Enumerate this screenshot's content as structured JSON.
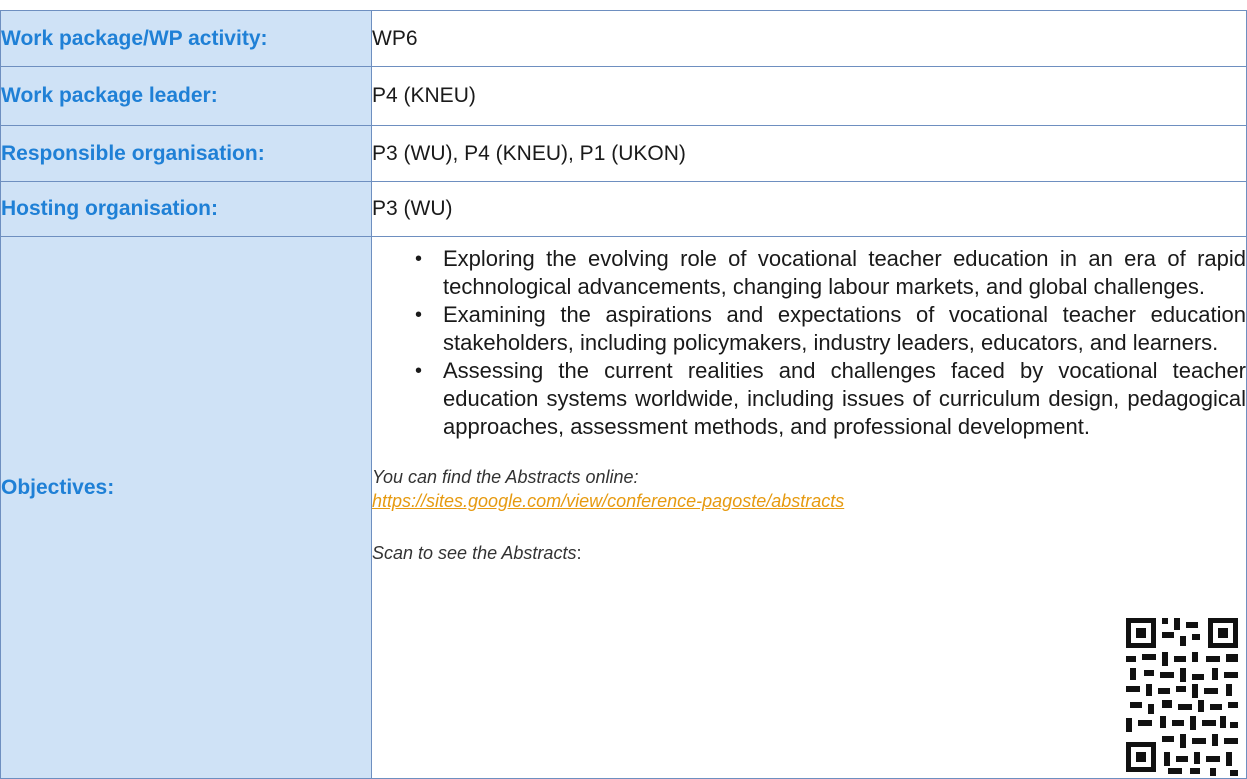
{
  "rows": [
    {
      "label": "Work package/WP activity:",
      "value": "WP6"
    },
    {
      "label": "Work package leader:",
      "value": "P4 (KNEU)"
    },
    {
      "label": "Responsible organisation:",
      "value": "P3 (WU), P4 (KNEU), P1 (UKON)"
    },
    {
      "label": "Hosting organisation:",
      "value": "P3 (WU)"
    }
  ],
  "objectives": {
    "label": "Objectives:",
    "items": [
      "Exploring the evolving role of vocational teacher education in an era of rapid technological advancements, changing labour markets, and global challenges.",
      "Examining the aspirations and expectations of vocational teacher education stakeholders, including policymakers, industry leaders, educators, and learners.",
      "Assessing the current realities and challenges faced by vocational teacher education systems worldwide, including issues of curriculum design, pedagogical approaches, assessment methods, and professional development."
    ],
    "abstracts_intro": "You can find the Abstracts online:",
    "abstracts_link": "https://sites.google.com/view/conference-pagoste/abstracts",
    "scan_text": "Scan to see the Abstracts",
    "scan_suffix": ":"
  },
  "colors": {
    "label_bg": "#cfe2f6",
    "label_text": "#1f80d6",
    "link": "#e69a10"
  },
  "icons": {
    "bullet": "•",
    "qr": "qr-code-icon"
  }
}
